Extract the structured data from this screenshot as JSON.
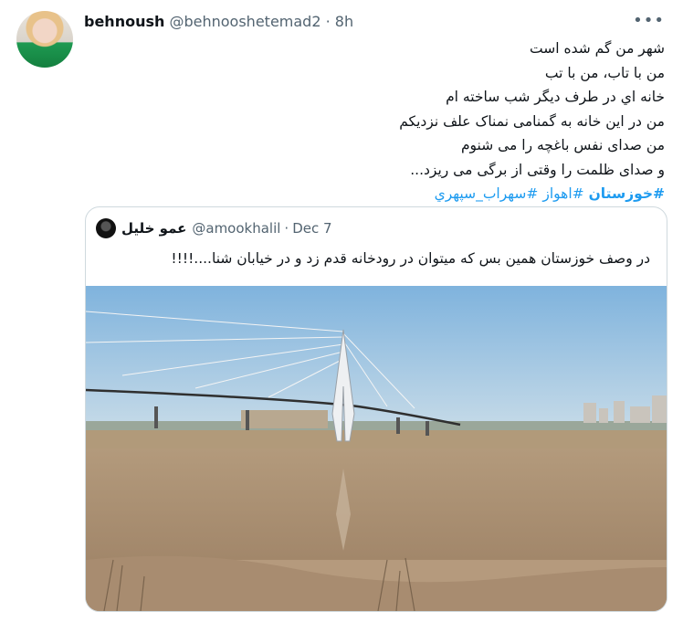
{
  "tweet": {
    "author_name": "behnoush",
    "author_handle": "@behnooshetemad2",
    "separator": "·",
    "time": "8h",
    "more_icon": "•••",
    "lines": [
      "شهر من گم شده است",
      "من با تاب، من با تب",
      "خانه اي در طرف ديگر شب ساخته ام",
      "من در اين خانه به گمنامی نمناک علف نزديکم",
      "من صدای نفس باغچه را می شنوم",
      "و صدای ظلمت را وقتی از برگی می ريزد..."
    ],
    "hashtags": [
      "#خوزستان",
      "#اهواز",
      "#سهراب_سپهري"
    ]
  },
  "quote": {
    "author_name": "عمو خلیل",
    "author_handle": "@amookhalil",
    "separator": "·",
    "time": "Dec 7",
    "text": "در وصف خوزستان همین بس که میتوان در رودخانه قدم زد و در خیابان شنا....!!!!"
  },
  "colors": {
    "link": "#1d9bf0",
    "muted": "#536471",
    "border": "#cfd9de"
  }
}
